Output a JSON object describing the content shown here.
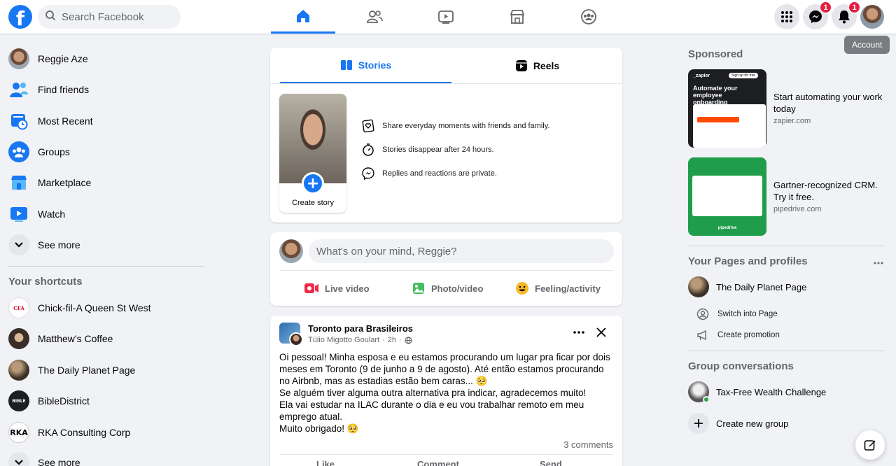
{
  "header": {
    "search_placeholder": "Search Facebook",
    "messenger_badge": "1",
    "notifications_badge": "1",
    "account_tooltip": "Account"
  },
  "sidebar": {
    "items": [
      {
        "label": "Reggie Aze"
      },
      {
        "label": "Find friends"
      },
      {
        "label": "Most Recent"
      },
      {
        "label": "Groups"
      },
      {
        "label": "Marketplace"
      },
      {
        "label": "Watch"
      },
      {
        "label": "See more"
      }
    ],
    "shortcuts_title": "Your shortcuts",
    "shortcuts": [
      {
        "label": "Chick-fil-A Queen St West"
      },
      {
        "label": "Matthew's Coffee"
      },
      {
        "label": "The Daily Planet Page"
      },
      {
        "label": "BibleDistrict"
      },
      {
        "label": "RKA Consulting Corp"
      },
      {
        "label": "See more"
      }
    ]
  },
  "stories": {
    "tab_stories": "Stories",
    "tab_reels": "Reels",
    "create_label": "Create story",
    "info": [
      "Share everyday moments with friends and family.",
      "Stories disappear after 24 hours.",
      "Replies and reactions are private."
    ]
  },
  "composer": {
    "placeholder": "What's on your mind, Reggie?",
    "live_video": "Live video",
    "photo_video": "Photo/video",
    "feeling": "Feeling/activity"
  },
  "post": {
    "group": "Toronto para Brasileiros",
    "author": "Túlio Migotto Goulart",
    "time": "2h",
    "lines": [
      "Oi pessoal! Minha esposa e eu estamos procurando um lugar pra ficar por dois meses em Toronto (9 de junho a 9 de agosto). Até então estamos procurando no Airbnb, mas as estadias estão bem caras...",
      "Se alguém tiver alguma outra alternativa pra indicar, agradecemos muito!",
      "Ela vai estudar na ILAC durante o dia e eu vou trabalhar remoto em meu emprego atual.",
      "Muito obrigado!"
    ],
    "comments": "3 comments",
    "like": "Like",
    "comment": "Comment",
    "send": "Send"
  },
  "right": {
    "sponsored": "Sponsored",
    "ads": [
      {
        "title": "Start automating your work today",
        "domain": "zapier.com",
        "brand": "_zapier",
        "headline": "Automate your employee onboarding",
        "cta": "Sign up for free"
      },
      {
        "title": "Gartner-recognized CRM. Try it free.",
        "domain": "pipedrive.com",
        "brand": "pipedrive"
      }
    ],
    "pages_title": "Your Pages and profiles",
    "page_name": "The Daily Planet Page",
    "switch": "Switch into Page",
    "promo": "Create promotion",
    "groups_title": "Group conversations",
    "group_name": "Tax-Free Wealth Challenge",
    "create_group": "Create new group"
  },
  "colors": {
    "brand": "#1877f2",
    "badge": "#e41e3f"
  }
}
